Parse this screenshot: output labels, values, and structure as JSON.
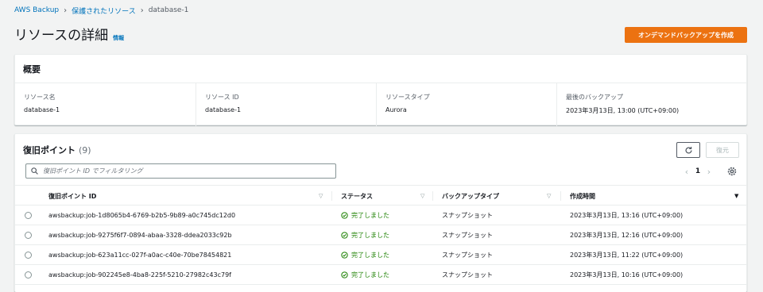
{
  "breadcrumb": {
    "items": [
      "AWS Backup",
      "保護されたリソース"
    ],
    "current": "database-1"
  },
  "header": {
    "title": "リソースの詳細",
    "info": "情報",
    "primary_button": "オンデマンドバックアップを作成"
  },
  "overview": {
    "title": "概要",
    "fields": [
      {
        "label": "リソース名",
        "value": "database-1"
      },
      {
        "label": "リソース ID",
        "value": "database-1"
      },
      {
        "label": "リソースタイプ",
        "value": "Aurora"
      },
      {
        "label": "最後のバックアップ",
        "value": "2023年3月13日, 13:00 (UTC+09:00)"
      }
    ]
  },
  "recovery_points": {
    "title": "復旧ポイント",
    "count": "(9)",
    "restore_button": "復元",
    "filter_placeholder": "復旧ポイント ID でフィルタリング",
    "page": "1",
    "columns": [
      "復旧ポイント ID",
      "ステータス",
      "バックアップタイプ",
      "作成時間"
    ],
    "rows": [
      {
        "id": "awsbackup:job-1d8065b4-6769-b2b5-9b89-a0c745dc12d0",
        "status": "完了しました",
        "type": "スナップショット",
        "created": "2023年3月13日, 13:16 (UTC+09:00)"
      },
      {
        "id": "awsbackup:job-9275f6f7-0894-abaa-3328-ddea2033c92b",
        "status": "完了しました",
        "type": "スナップショット",
        "created": "2023年3月13日, 12:16 (UTC+09:00)"
      },
      {
        "id": "awsbackup:job-623a11cc-027f-a0ac-c40e-70be78454821",
        "status": "完了しました",
        "type": "スナップショット",
        "created": "2023年3月13日, 11:22 (UTC+09:00)"
      },
      {
        "id": "awsbackup:job-902245e8-4ba8-225f-5210-27982c43c79f",
        "status": "完了しました",
        "type": "スナップショット",
        "created": "2023年3月13日, 10:16 (UTC+09:00)"
      }
    ]
  },
  "colors": {
    "primary": "#ec7211",
    "link": "#0073bb",
    "success": "#1d8102"
  }
}
